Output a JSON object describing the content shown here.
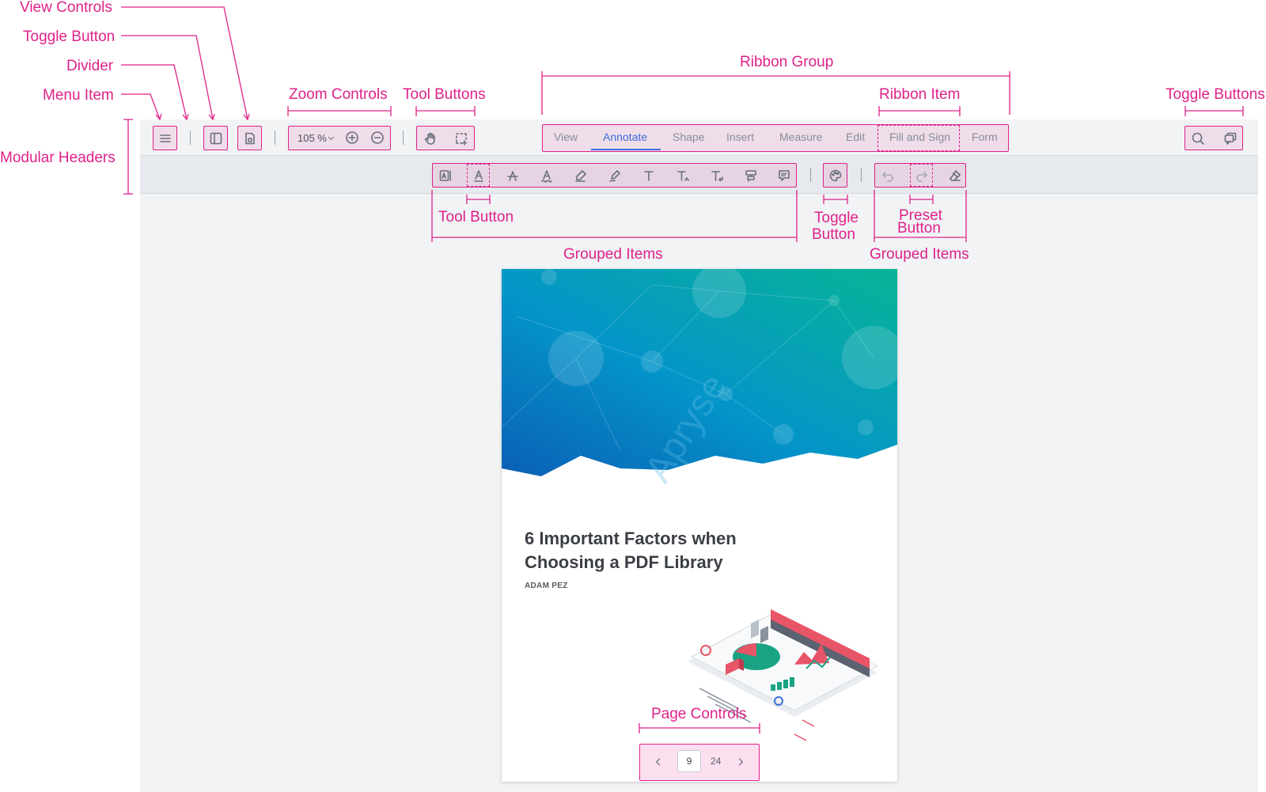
{
  "annotations": {
    "view_controls": "View Controls",
    "toggle_button": "Toggle Button",
    "divider": "Divider",
    "menu_item": "Menu Item",
    "modular_headers": "Modular Headers",
    "zoom_controls": "Zoom Controls",
    "tool_buttons": "Tool Buttons",
    "ribbon_group": "Ribbon Group",
    "ribbon_item": "Ribbon Item",
    "toggle_buttons": "Toggle Buttons",
    "tool_button": "Tool Button",
    "toggle_button_2_line1": "Toggle",
    "toggle_button_2_line2": "Button",
    "preset_button_line1": "Preset",
    "preset_button_line2": "Button",
    "grouped_items_1": "Grouped Items",
    "grouped_items_2": "Grouped Items",
    "page_controls": "Page Controls"
  },
  "zoom": {
    "value": "105 %"
  },
  "ribbon": {
    "items": [
      "View",
      "Annotate",
      "Shape",
      "Insert",
      "Measure",
      "Edit",
      "Fill and Sign",
      "Form"
    ],
    "active": "Annotate"
  },
  "document": {
    "title_line1": "6 Important Factors when",
    "title_line2": "Choosing a PDF Library",
    "author": "ADAM PEZ",
    "watermark": "Apryse"
  },
  "page_controls": {
    "current": "9",
    "total": "24"
  },
  "colors": {
    "annotation": "#e0218a",
    "accent": "#3b6fd8",
    "header_bg": "#f1f3f5",
    "toolbar_bg": "#e6e9ed"
  }
}
